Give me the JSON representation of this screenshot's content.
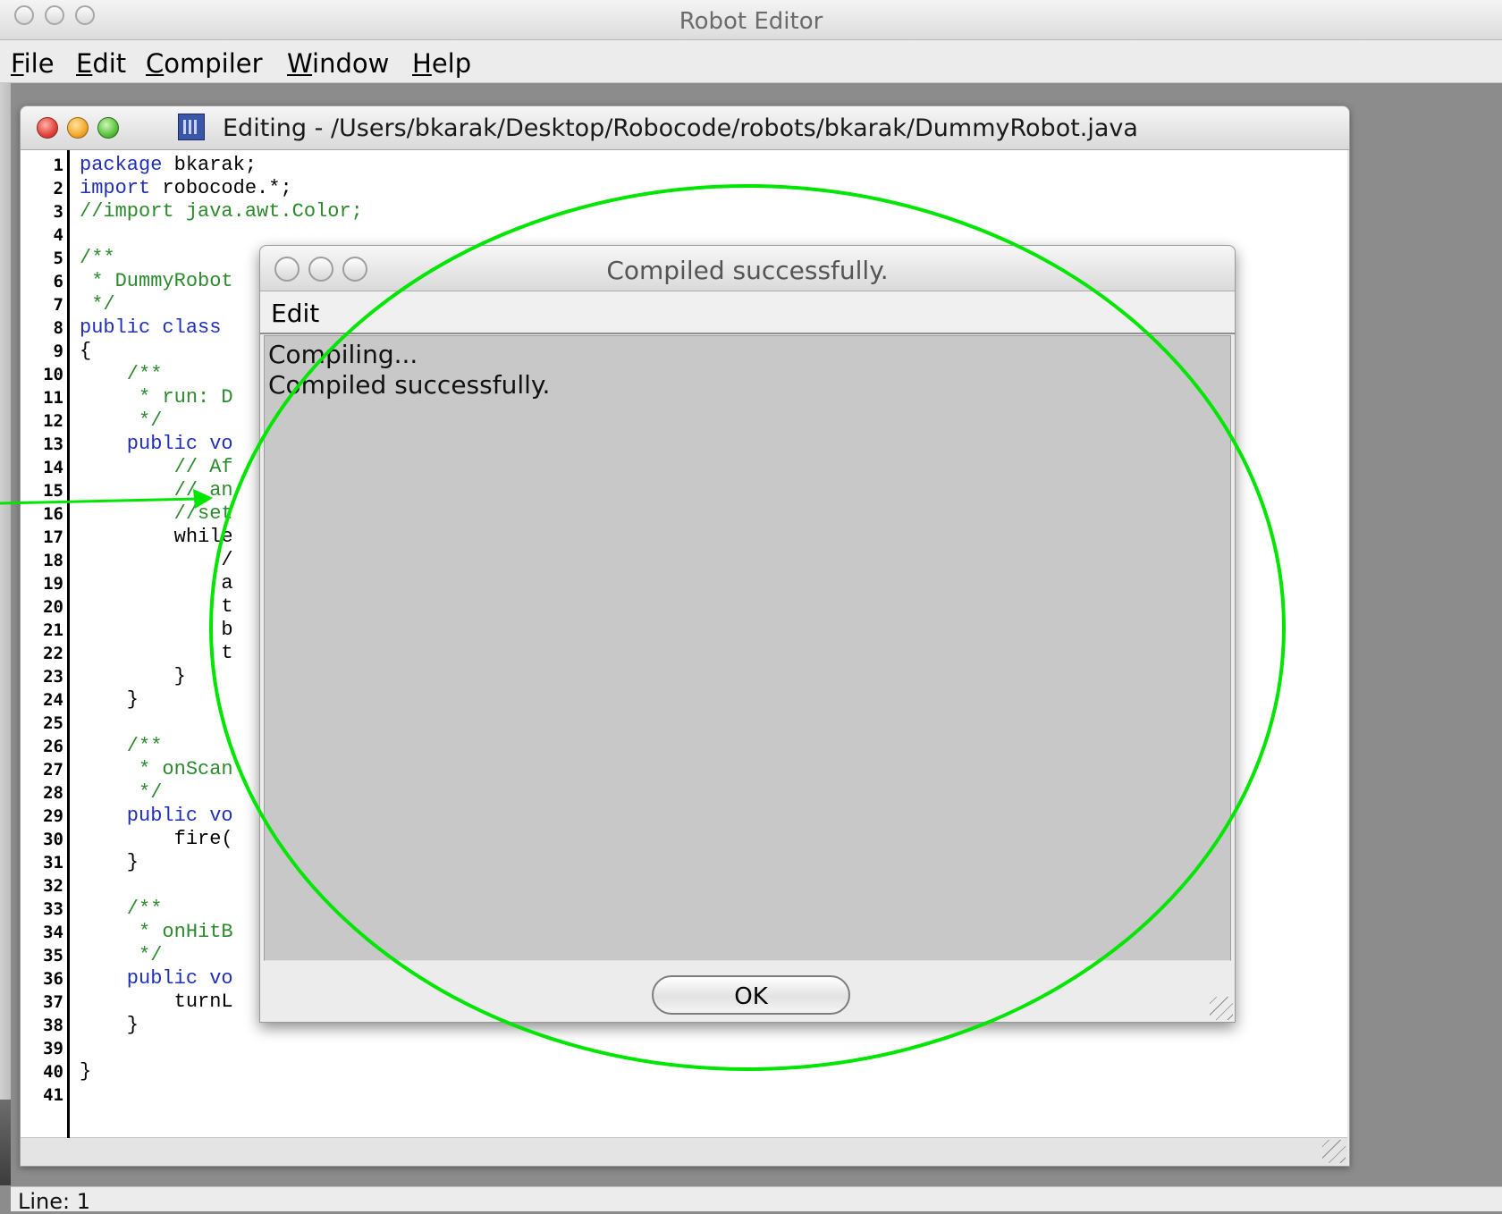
{
  "window": {
    "title": "Robot Editor"
  },
  "menubar": {
    "items": [
      {
        "label": "File",
        "mnemonic": "F",
        "rest": "ile"
      },
      {
        "label": "Edit",
        "mnemonic": "E",
        "rest": "dit"
      },
      {
        "label": "Compiler",
        "mnemonic": "C",
        "rest": "ompiler"
      },
      {
        "label": "Window",
        "mnemonic": "W",
        "rest": "indow"
      },
      {
        "label": "Help",
        "mnemonic": "H",
        "rest": "elp"
      }
    ]
  },
  "editor": {
    "title": "Editing - /Users/bkarak/Desktop/Robocode/robots/bkarak/DummyRobot.java",
    "line_numbers": [
      "1",
      "2",
      "3",
      "4",
      "5",
      "6",
      "7",
      "8",
      "9",
      "10",
      "11",
      "12",
      "13",
      "14",
      "15",
      "16",
      "17",
      "18",
      "19",
      "20",
      "21",
      "22",
      "23",
      "24",
      "25",
      "26",
      "27",
      "28",
      "29",
      "30",
      "31",
      "32",
      "33",
      "34",
      "35",
      "36",
      "37",
      "38",
      "39",
      "40",
      "41"
    ],
    "code_lines": [
      {
        "line": 1,
        "text": "package bkarak;"
      },
      {
        "line": 2,
        "text": "import robocode.*;"
      },
      {
        "line": 3,
        "text": "//import java.awt.Color;"
      },
      {
        "line": 5,
        "text": "/**"
      },
      {
        "line": 6,
        "text": " * DummyRobot"
      },
      {
        "line": 7,
        "text": " */"
      },
      {
        "line": 8,
        "text": "public class"
      },
      {
        "line": 9,
        "text": "{"
      },
      {
        "line": 10,
        "text": "    /**"
      },
      {
        "line": 11,
        "text": "     * run: D"
      },
      {
        "line": 12,
        "text": "     */"
      },
      {
        "line": 13,
        "text": "    public vo"
      },
      {
        "line": 14,
        "text": "        // Af"
      },
      {
        "line": 15,
        "text": "        // an"
      },
      {
        "line": 16,
        "text": "        //set"
      },
      {
        "line": 17,
        "text": "        while"
      },
      {
        "line": 18,
        "text": "            /"
      },
      {
        "line": 19,
        "text": "            a"
      },
      {
        "line": 20,
        "text": "            t"
      },
      {
        "line": 21,
        "text": "            b"
      },
      {
        "line": 22,
        "text": "            t"
      },
      {
        "line": 23,
        "text": "        }"
      },
      {
        "line": 24,
        "text": "    }"
      },
      {
        "line": 26,
        "text": "    /**"
      },
      {
        "line": 27,
        "text": "     * onScan"
      },
      {
        "line": 28,
        "text": "     */"
      },
      {
        "line": 29,
        "text": "    public vo"
      },
      {
        "line": 30,
        "text": "        fire("
      },
      {
        "line": 31,
        "text": "    }"
      },
      {
        "line": 33,
        "text": "    /**"
      },
      {
        "line": 34,
        "text": "     * onHitB"
      },
      {
        "line": 35,
        "text": "     */"
      },
      {
        "line": 36,
        "text": "    public vo"
      },
      {
        "line": 37,
        "text": "        turnL"
      },
      {
        "line": 38,
        "text": "    }"
      },
      {
        "line": 40,
        "text": "}"
      }
    ]
  },
  "dialog": {
    "title": "Compiled successfully.",
    "menu_edit": "Edit",
    "output_lines": [
      "Compiling...",
      "Compiled successfully."
    ],
    "ok_label": "OK"
  },
  "status_bar": {
    "text": "Line: 1"
  },
  "colors": {
    "keyword": "#1f2fb8",
    "comment": "#2b8a2b",
    "annotation": "#00e600",
    "desktop": "#8c8c8c"
  }
}
